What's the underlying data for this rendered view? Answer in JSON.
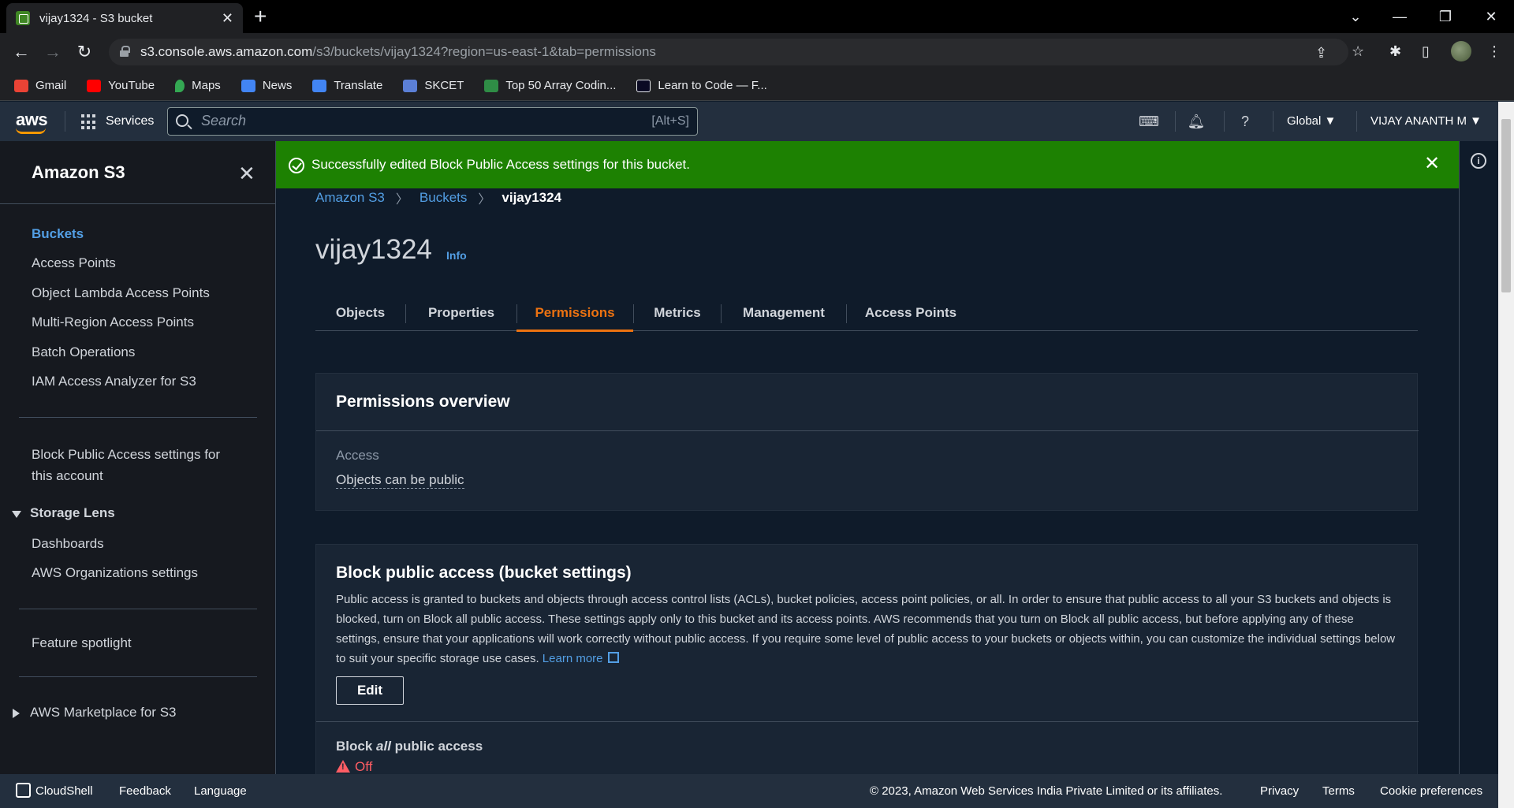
{
  "browser": {
    "tab_title": "vijay1324 - S3 bucket",
    "url_host": "s3.console.aws.amazon.com",
    "url_path": "/s3/buckets/vijay1324?region=us-east-1&tab=permissions",
    "bookmarks": [
      {
        "label": "Gmail",
        "color": "#ea4335"
      },
      {
        "label": "YouTube",
        "color": "#ff0000"
      },
      {
        "label": "Maps",
        "color": "#34a853"
      },
      {
        "label": "News",
        "color": "#4285f4"
      },
      {
        "label": "Translate",
        "color": "#4285f4"
      },
      {
        "label": "SKCET",
        "color": "#5b7fd6"
      },
      {
        "label": "Top 50 Array Codin...",
        "color": "#2f8d46"
      },
      {
        "label": "Learn to Code — F...",
        "color": "#0a0a23"
      }
    ]
  },
  "aws_nav": {
    "logo": "aws",
    "services": "Services",
    "search_placeholder": "Search",
    "search_shortcut": "[Alt+S]",
    "region": "Global ▼",
    "user": "VIJAY ANANTH M ▼"
  },
  "sidenav": {
    "title": "Amazon S3",
    "items": [
      "Buckets",
      "Access Points",
      "Object Lambda Access Points",
      "Multi-Region Access Points",
      "Batch Operations",
      "IAM Access Analyzer for S3"
    ],
    "block_public_access_line1": "Block Public Access settings for",
    "block_public_access_line2": "this account",
    "storage_lens": "Storage Lens",
    "storage_lens_items": [
      "Dashboards",
      "AWS Organizations settings"
    ],
    "feature_spotlight": "Feature spotlight",
    "marketplace": "AWS Marketplace for S3"
  },
  "flash": {
    "message": "Successfully edited Block Public Access settings for this bucket."
  },
  "breadcrumb": [
    "Amazon S3",
    "Buckets",
    "vijay1324"
  ],
  "page": {
    "title": "vijay1324",
    "info": "Info"
  },
  "tabs": [
    "Objects",
    "Properties",
    "Permissions",
    "Metrics",
    "Management",
    "Access Points"
  ],
  "active_tab": "Permissions",
  "permissions_overview": {
    "heading": "Permissions overview",
    "access_label": "Access",
    "access_value": "Objects can be public"
  },
  "block_public_access": {
    "heading": "Block public access (bucket settings)",
    "description": "Public access is granted to buckets and objects through access control lists (ACLs), bucket policies, access point policies, or all. In order to ensure that public access to all your S3 buckets and objects is blocked, turn on Block all public access. These settings apply only to this bucket and its access points. AWS recommends that you turn on Block all public access, but before applying any of these settings, ensure that your applications will work correctly without public access. If you require some level of public access to your buckets or objects within, you can customize the individual settings below to suit your specific storage use cases.",
    "learn_more": "Learn more",
    "edit": "Edit",
    "block_all_prefix": "Block ",
    "block_all_em": "all",
    "block_all_suffix": " public access",
    "status": "Off"
  },
  "footer": {
    "cloudshell": "CloudShell",
    "feedback": "Feedback",
    "language": "Language",
    "copyright": "© 2023, Amazon Web Services India Private Limited or its affiliates.",
    "privacy": "Privacy",
    "terms": "Terms",
    "cookie": "Cookie preferences"
  },
  "colors": {
    "accent_orange": "#ec7211",
    "link_blue": "#539fe5",
    "success_green": "#1d8102",
    "danger_red": "#ff5d64"
  }
}
